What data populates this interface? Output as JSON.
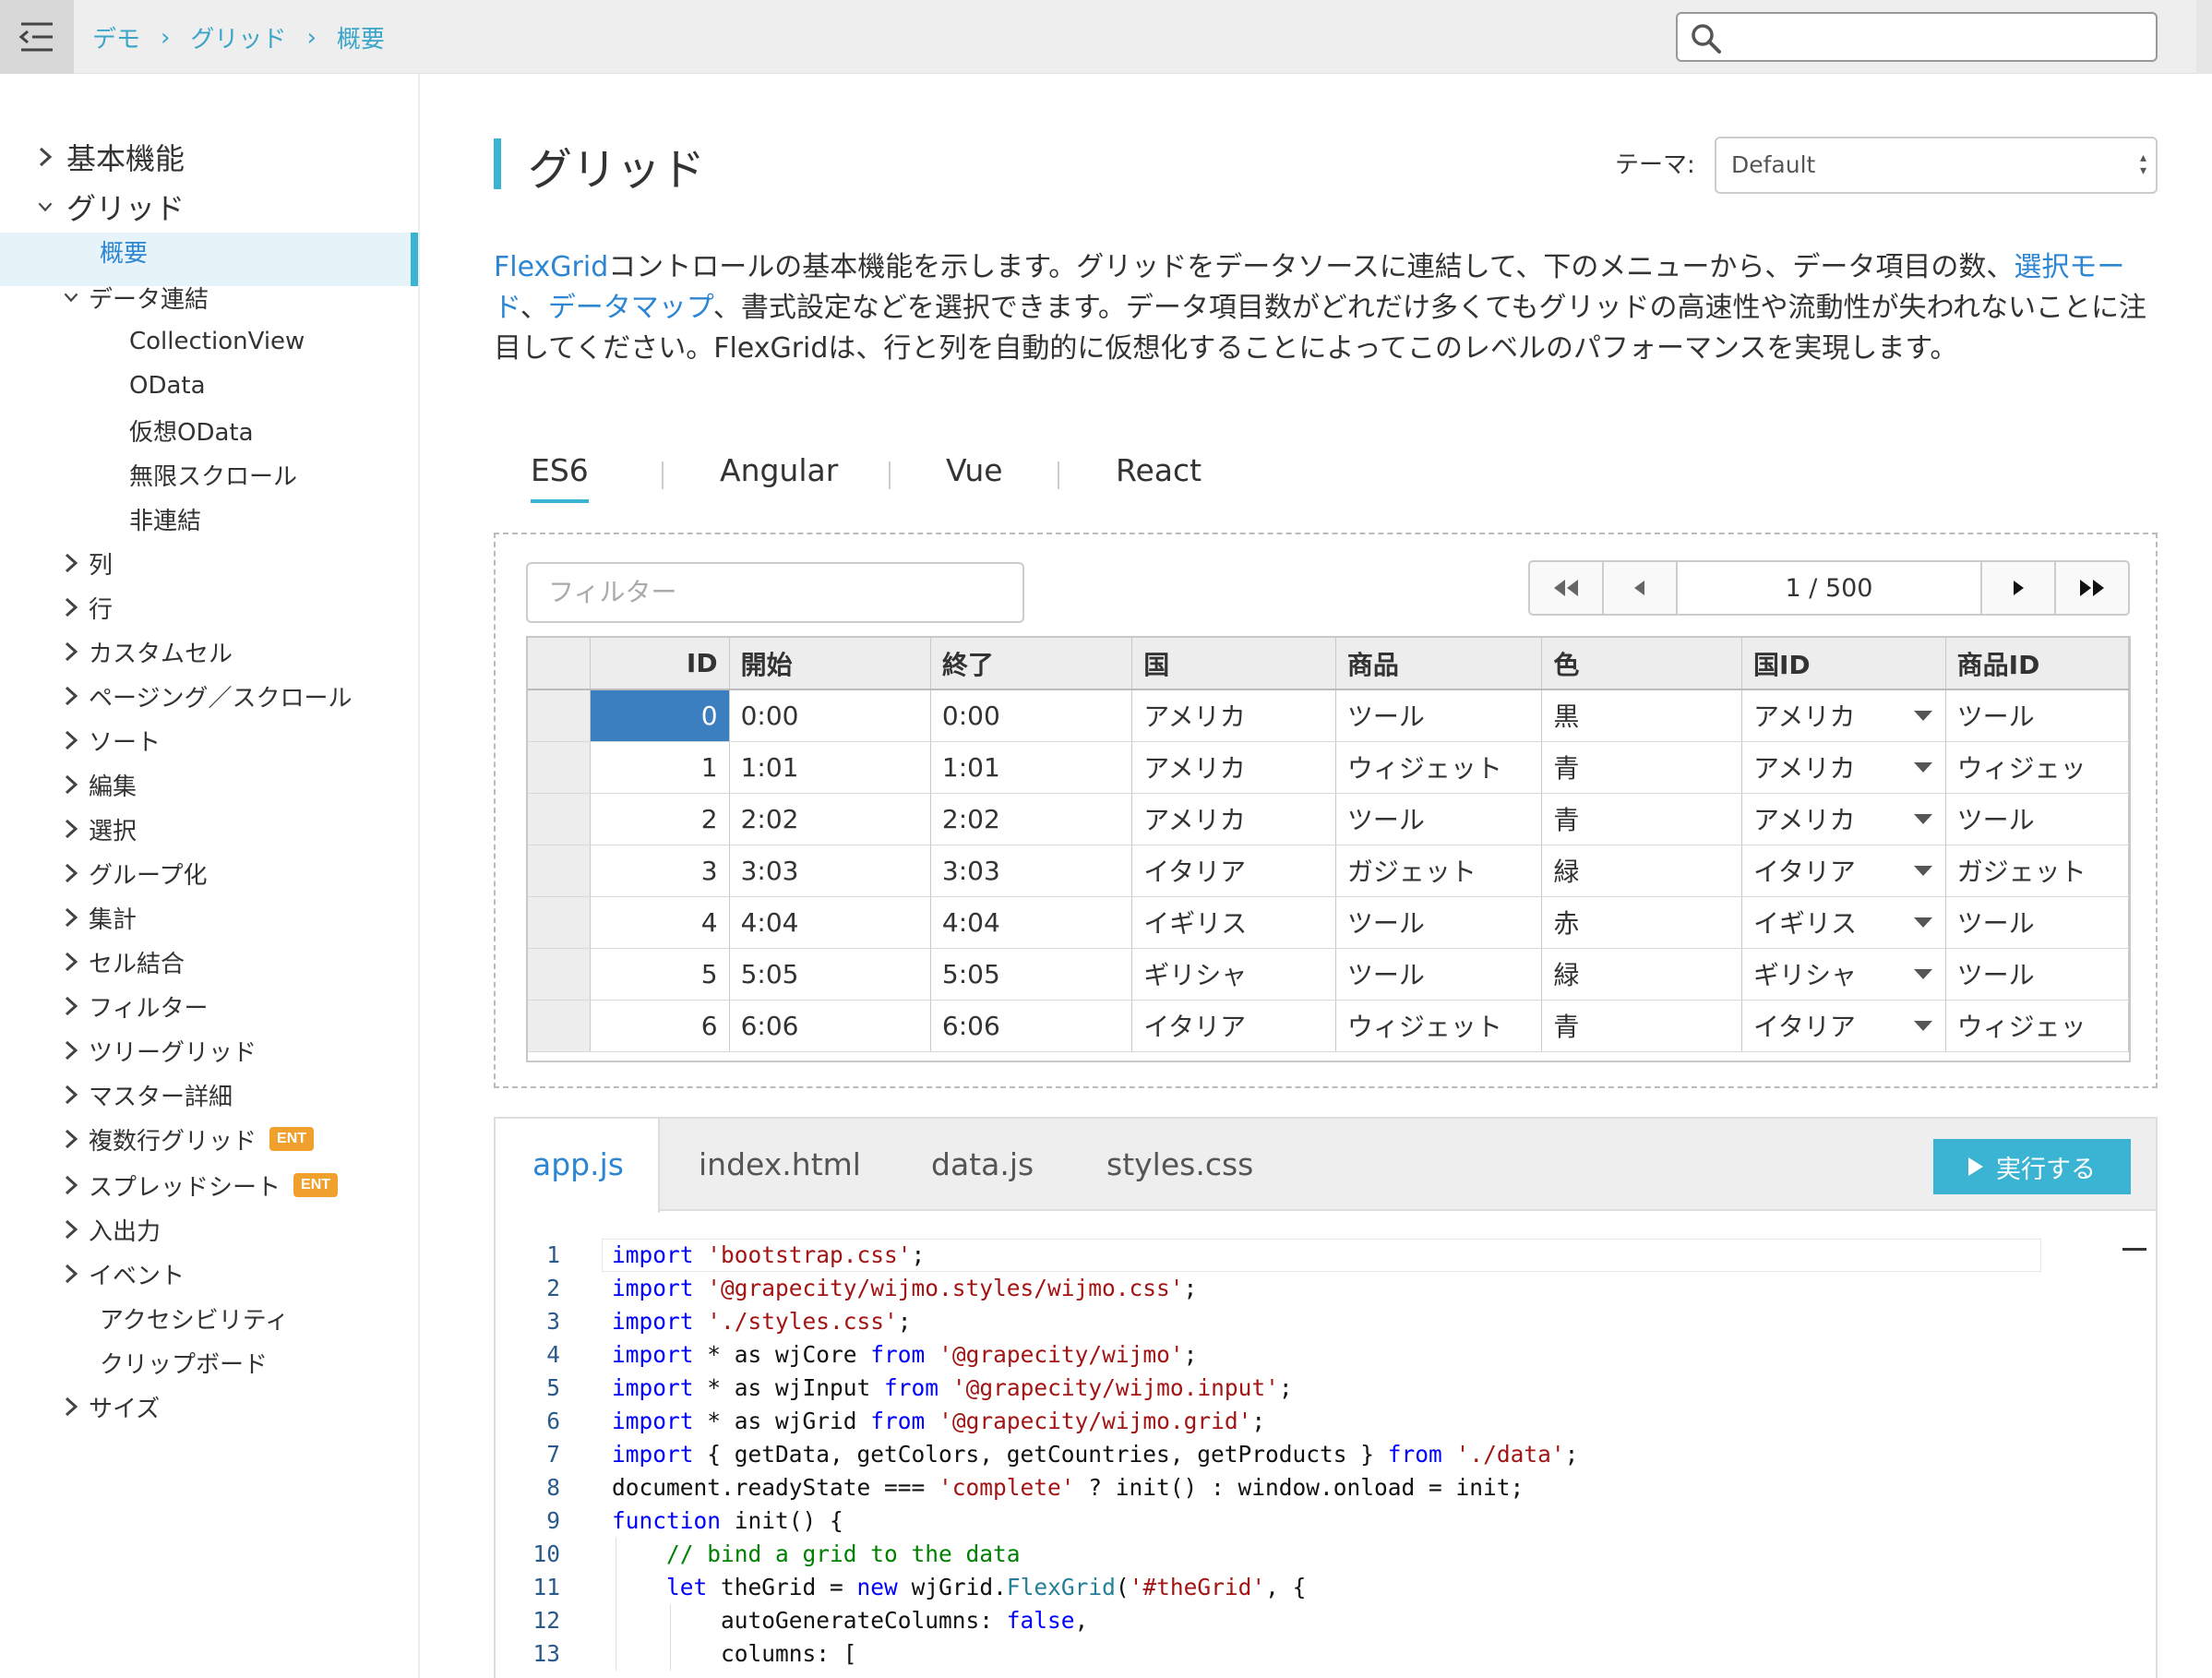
{
  "breadcrumb": [
    "デモ",
    "グリッド",
    "概要"
  ],
  "search": {
    "value": ""
  },
  "sidebar": {
    "items": [
      {
        "label": "基本機能",
        "chev": "right",
        "level": 0
      },
      {
        "label": "グリッド",
        "chev": "down",
        "level": 0
      },
      {
        "label": "概要",
        "chev": "none",
        "level": 1,
        "active": true
      },
      {
        "label": "データ連結",
        "chev": "down",
        "level": 1
      },
      {
        "label": "CollectionView",
        "chev": "none",
        "level": 2
      },
      {
        "label": "OData",
        "chev": "none",
        "level": 2
      },
      {
        "label": "仮想OData",
        "chev": "none",
        "level": 2
      },
      {
        "label": "無限スクロール",
        "chev": "none",
        "level": 2
      },
      {
        "label": "非連結",
        "chev": "none",
        "level": 2
      },
      {
        "label": "列",
        "chev": "right",
        "level": 1
      },
      {
        "label": "行",
        "chev": "right",
        "level": 1
      },
      {
        "label": "カスタムセル",
        "chev": "right",
        "level": 1
      },
      {
        "label": "ページング／スクロール",
        "chev": "right",
        "level": 1
      },
      {
        "label": "ソート",
        "chev": "right",
        "level": 1
      },
      {
        "label": "編集",
        "chev": "right",
        "level": 1
      },
      {
        "label": "選択",
        "chev": "right",
        "level": 1
      },
      {
        "label": "グループ化",
        "chev": "right",
        "level": 1
      },
      {
        "label": "集計",
        "chev": "right",
        "level": 1
      },
      {
        "label": "セル結合",
        "chev": "right",
        "level": 1
      },
      {
        "label": "フィルター",
        "chev": "right",
        "level": 1
      },
      {
        "label": "ツリーグリッド",
        "chev": "right",
        "level": 1
      },
      {
        "label": "マスター詳細",
        "chev": "right",
        "level": 1
      },
      {
        "label": "複数行グリッド",
        "chev": "right",
        "level": 1,
        "badge": "ENT"
      },
      {
        "label": "スプレッドシート",
        "chev": "right",
        "level": 1,
        "badge": "ENT"
      },
      {
        "label": "入出力",
        "chev": "right",
        "level": 1
      },
      {
        "label": "イベント",
        "chev": "right",
        "level": 1
      },
      {
        "label": "アクセシビリティ",
        "chev": "none",
        "level": 1
      },
      {
        "label": "クリップボード",
        "chev": "none",
        "level": 1
      },
      {
        "label": "サイズ",
        "chev": "right",
        "level": 1
      }
    ]
  },
  "main": {
    "title": "グリッド",
    "theme_label": "テーマ:",
    "theme_value": "Default",
    "description": {
      "link1": "FlexGrid",
      "text1": "コントロールの基本機能を示します。グリッドをデータソースに連結して、下のメニューから、データ項目の数、",
      "link2": "選択モード",
      "sep": "、",
      "link3": "データマップ",
      "text2": "、書式設定などを選択できます。データ項目数がどれだけ多くてもグリッドの高速性や流動性が失われないことに注目してください。FlexGridは、行と列を自動的に仮想化することによってこのレベルのパフォーマンスを実現します。"
    },
    "framework_tabs": [
      "ES6",
      "Angular",
      "Vue",
      "React"
    ],
    "active_framework": "ES6"
  },
  "demo": {
    "filter_placeholder": "フィルター",
    "pager_text": "1 / 500",
    "columns": [
      "ID",
      "開始",
      "終了",
      "国",
      "商品",
      "色",
      "国ID",
      "商品ID"
    ],
    "rows": [
      [
        "0",
        "0:00",
        "0:00",
        "アメリカ",
        "ツール",
        "黒",
        "アメリカ",
        "ツール"
      ],
      [
        "1",
        "1:01",
        "1:01",
        "アメリカ",
        "ウィジェット",
        "青",
        "アメリカ",
        "ウィジェッ"
      ],
      [
        "2",
        "2:02",
        "2:02",
        "アメリカ",
        "ツール",
        "青",
        "アメリカ",
        "ツール"
      ],
      [
        "3",
        "3:03",
        "3:03",
        "イタリア",
        "ガジェット",
        "緑",
        "イタリア",
        "ガジェット"
      ],
      [
        "4",
        "4:04",
        "4:04",
        "イギリス",
        "ツール",
        "赤",
        "イギリス",
        "ツール"
      ],
      [
        "5",
        "5:05",
        "5:05",
        "ギリシャ",
        "ツール",
        "緑",
        "ギリシャ",
        "ツール"
      ],
      [
        "6",
        "6:06",
        "6:06",
        "イタリア",
        "ウィジェット",
        "青",
        "イタリア",
        "ウィジェッ"
      ]
    ]
  },
  "code_panel": {
    "tabs": [
      "app.js",
      "index.html",
      "data.js",
      "styles.css"
    ],
    "active_tab": "app.js",
    "run_label": "実行する",
    "lines": [
      [
        [
          "kw",
          "import"
        ],
        [
          "t",
          " "
        ],
        [
          "str",
          "'bootstrap.css'"
        ],
        [
          "t",
          ";"
        ]
      ],
      [
        [
          "kw",
          "import"
        ],
        [
          "t",
          " "
        ],
        [
          "str",
          "'@grapecity/wijmo.styles/wijmo.css'"
        ],
        [
          "t",
          ";"
        ]
      ],
      [
        [
          "kw",
          "import"
        ],
        [
          "t",
          " "
        ],
        [
          "str",
          "'./styles.css'"
        ],
        [
          "t",
          ";"
        ]
      ],
      [
        [
          "kw",
          "import"
        ],
        [
          "t",
          " * as wjCore "
        ],
        [
          "kw",
          "from"
        ],
        [
          "t",
          " "
        ],
        [
          "str",
          "'@grapecity/wijmo'"
        ],
        [
          "t",
          ";"
        ]
      ],
      [
        [
          "kw",
          "import"
        ],
        [
          "t",
          " * as wjInput "
        ],
        [
          "kw",
          "from"
        ],
        [
          "t",
          " "
        ],
        [
          "str",
          "'@grapecity/wijmo.input'"
        ],
        [
          "t",
          ";"
        ]
      ],
      [
        [
          "kw",
          "import"
        ],
        [
          "t",
          " * as wjGrid "
        ],
        [
          "kw",
          "from"
        ],
        [
          "t",
          " "
        ],
        [
          "str",
          "'@grapecity/wijmo.grid'"
        ],
        [
          "t",
          ";"
        ]
      ],
      [
        [
          "kw",
          "import"
        ],
        [
          "t",
          " { getData, getColors, getCountries, getProducts } "
        ],
        [
          "kw",
          "from"
        ],
        [
          "t",
          " "
        ],
        [
          "str",
          "'./data'"
        ],
        [
          "t",
          ";"
        ]
      ],
      [
        [
          "t",
          "document.readyState === "
        ],
        [
          "str",
          "'complete'"
        ],
        [
          "t",
          " ? init() : window.onload = init;"
        ]
      ],
      [
        [
          "kw",
          "function"
        ],
        [
          "t",
          " init() {"
        ]
      ],
      [
        [
          "t",
          "    "
        ],
        [
          "cm",
          "// bind a grid to the data"
        ]
      ],
      [
        [
          "t",
          "    "
        ],
        [
          "kw",
          "let"
        ],
        [
          "t",
          " theGrid = "
        ],
        [
          "kw",
          "new"
        ],
        [
          "t",
          " wjGrid."
        ],
        [
          "fn",
          "FlexGrid"
        ],
        [
          "t",
          "("
        ],
        [
          "str",
          "'#theGrid'"
        ],
        [
          "t",
          ", {"
        ]
      ],
      [
        [
          "t",
          "        autoGenerateColumns: "
        ],
        [
          "kw",
          "false"
        ],
        [
          "t",
          ","
        ]
      ],
      [
        [
          "t",
          "        columns: ["
        ]
      ]
    ]
  },
  "colors": {
    "accent": "#3bb4d3",
    "link": "#2c86d3",
    "selected_cell": "#3c7fc1",
    "badge": "#f0a02c"
  }
}
